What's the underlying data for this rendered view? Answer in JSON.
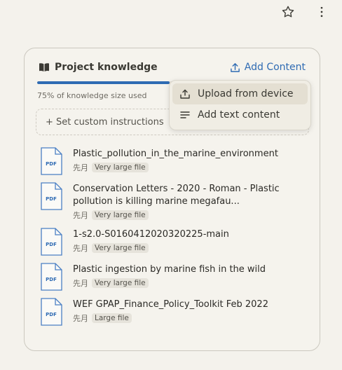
{
  "panel": {
    "title": "Project knowledge",
    "add_content_label": "Add Content",
    "usage_text": "75% of knowledge size used",
    "usage_fraction": 0.49,
    "instructions_label": "+ Set custom instructions"
  },
  "dropdown": {
    "items": [
      {
        "label": "Upload from device",
        "icon": "upload-icon"
      },
      {
        "label": "Add text content",
        "icon": "text-lines-icon"
      }
    ]
  },
  "files": [
    {
      "name": "Plastic_pollution_in_the_marine_environment",
      "date": "先月",
      "badge": "Very large file",
      "type": "PDF"
    },
    {
      "name": "Conservation Letters - 2020 - Roman - Plastic pollution is killing marine megafau...",
      "date": "先月",
      "badge": "Very large file",
      "type": "PDF"
    },
    {
      "name": "1-s2.0-S0160412020320225-main",
      "date": "先月",
      "badge": "Very large file",
      "type": "PDF"
    },
    {
      "name": "Plastic ingestion by marine fish in the wild",
      "date": "先月",
      "badge": "Very large file",
      "type": "PDF"
    },
    {
      "name": "WEF GPAP_Finance_Policy_Toolkit Feb 2022",
      "date": "先月",
      "badge": "Large file",
      "type": "PDF"
    }
  ],
  "colors": {
    "accent": "#2f6bb3",
    "background": "#f4f2ec"
  }
}
